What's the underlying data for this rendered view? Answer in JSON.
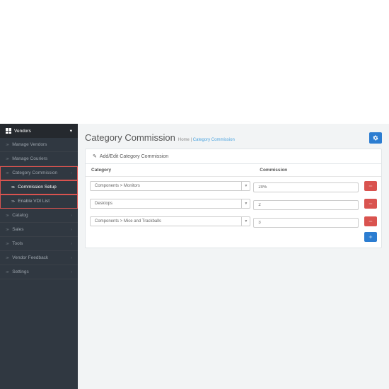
{
  "sidebar": {
    "header": "Vendors",
    "items": [
      {
        "label": "Manage Vendors"
      },
      {
        "label": "Manage Couriers"
      },
      {
        "label": "Category Commission",
        "expandable": true,
        "hl": true,
        "subs": [
          {
            "label": "Commission Setup",
            "active": true
          },
          {
            "label": "Enable VDI List"
          }
        ]
      },
      {
        "label": "Catalog",
        "expandable": true
      },
      {
        "label": "Sales",
        "expandable": true
      },
      {
        "label": "Tools",
        "expandable": true
      },
      {
        "label": "Vendor Feedback",
        "expandable": true
      },
      {
        "label": "Settings",
        "expandable": true
      }
    ]
  },
  "page": {
    "title": "Category Commission",
    "crumb_home": "Home",
    "crumb_current": "Category Commission"
  },
  "panel": {
    "heading": "Add/Edit Category Commission",
    "th_category": "Category",
    "th_commission": "Commission"
  },
  "rows": [
    {
      "category": "Components  >  Monitors",
      "commission": "20%"
    },
    {
      "category": "Desktops",
      "commission": "2"
    },
    {
      "category": "Components  >  Mice and Trackballs",
      "commission": "3"
    }
  ]
}
